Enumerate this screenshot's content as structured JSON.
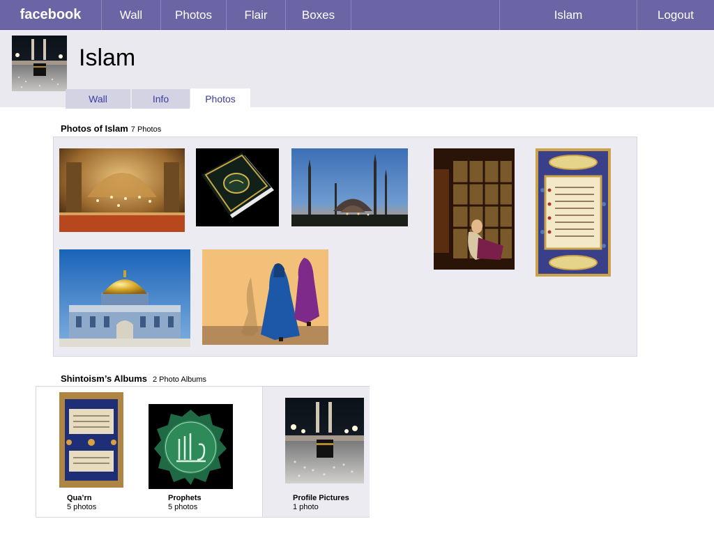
{
  "nav": {
    "logo": "facebook",
    "items": [
      "Wall",
      "Photos",
      "Flair",
      "Boxes"
    ],
    "profile_link": "Islam",
    "logout": "Logout"
  },
  "profile": {
    "name": "Islam",
    "tabs": [
      {
        "label": "Wall",
        "active": false
      },
      {
        "label": "Info",
        "active": false
      },
      {
        "label": "Photos",
        "active": true
      }
    ]
  },
  "photos_section": {
    "title": "Photos of Islam",
    "count": "7 Photos",
    "photos": [
      {
        "subject": "mosque-interior"
      },
      {
        "subject": "quran-book"
      },
      {
        "subject": "blue-mosque-dusk"
      },
      {
        "subject": "woman-at-window"
      },
      {
        "subject": "illuminated-manuscript"
      },
      {
        "subject": "dome-of-the-rock"
      },
      {
        "subject": "women-in-burqas"
      }
    ]
  },
  "albums_section": {
    "title": "Shintoism’s Albums",
    "count": "2 Photo Albums",
    "albums": [
      {
        "name": "Qua’rn",
        "count": "5 photos"
      },
      {
        "name": "Prophets",
        "count": "5 photos"
      },
      {
        "name": "Profile Pictures",
        "count": "1 photo"
      }
    ]
  },
  "colors": {
    "nav_bg": "#6b64a5",
    "header_bg": "#e9e9ef",
    "link": "#3b3a9e",
    "panel_bg": "#ebebf1"
  }
}
